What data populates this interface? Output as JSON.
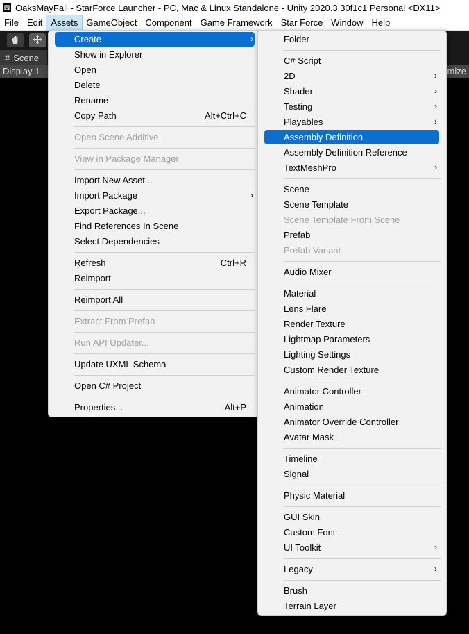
{
  "window": {
    "title": "OaksMayFall - StarForce Launcher - PC, Mac & Linux Standalone - Unity 2020.3.30f1c1 Personal <DX11>"
  },
  "menubar": [
    "File",
    "Edit",
    "Assets",
    "GameObject",
    "Component",
    "Game Framework",
    "Star Force",
    "Window",
    "Help"
  ],
  "scene": {
    "tab_label": "Scene",
    "tab_icon": "#",
    "display": "Display 1",
    "maximize": "imize"
  },
  "assets_menu": {
    "items": [
      {
        "label": "Create",
        "arrow": "›"
      },
      {
        "label": "Show in Explorer"
      },
      {
        "label": "Open"
      },
      {
        "label": "Delete"
      },
      {
        "label": "Rename"
      },
      {
        "label": "Copy Path",
        "shortcut": "Alt+Ctrl+C"
      },
      {
        "label": "Open Scene Additive"
      },
      {
        "label": "View in Package Manager"
      },
      {
        "label": "Import New Asset..."
      },
      {
        "label": "Import Package",
        "arrow": "›"
      },
      {
        "label": "Export Package..."
      },
      {
        "label": "Find References In Scene"
      },
      {
        "label": "Select Dependencies"
      },
      {
        "label": "Refresh",
        "shortcut": "Ctrl+R"
      },
      {
        "label": "Reimport"
      },
      {
        "label": "Reimport All"
      },
      {
        "label": "Extract From Prefab"
      },
      {
        "label": "Run API Updater..."
      },
      {
        "label": "Update UXML Schema"
      },
      {
        "label": "Open C# Project"
      },
      {
        "label": "Properties...",
        "shortcut": "Alt+P"
      }
    ]
  },
  "create_menu": {
    "items": [
      {
        "label": "Folder"
      },
      {
        "label": "C# Script"
      },
      {
        "label": "2D",
        "arrow": "›"
      },
      {
        "label": "Shader",
        "arrow": "›"
      },
      {
        "label": "Testing",
        "arrow": "›"
      },
      {
        "label": "Playables",
        "arrow": "›"
      },
      {
        "label": "Assembly Definition"
      },
      {
        "label": "Assembly Definition Reference"
      },
      {
        "label": "TextMeshPro",
        "arrow": "›"
      },
      {
        "label": "Scene"
      },
      {
        "label": "Scene Template"
      },
      {
        "label": "Scene Template From Scene"
      },
      {
        "label": "Prefab"
      },
      {
        "label": "Prefab Variant"
      },
      {
        "label": "Audio Mixer"
      },
      {
        "label": "Material"
      },
      {
        "label": "Lens Flare"
      },
      {
        "label": "Render Texture"
      },
      {
        "label": "Lightmap Parameters"
      },
      {
        "label": "Lighting Settings"
      },
      {
        "label": "Custom Render Texture"
      },
      {
        "label": "Animator Controller"
      },
      {
        "label": "Animation"
      },
      {
        "label": "Animator Override Controller"
      },
      {
        "label": "Avatar Mask"
      },
      {
        "label": "Timeline"
      },
      {
        "label": "Signal"
      },
      {
        "label": "Physic Material"
      },
      {
        "label": "GUI Skin"
      },
      {
        "label": "Custom Font"
      },
      {
        "label": "UI Toolkit",
        "arrow": "›"
      },
      {
        "label": "Legacy",
        "arrow": "›"
      },
      {
        "label": "Brush"
      },
      {
        "label": "Terrain Layer"
      }
    ]
  },
  "colors": {
    "highlight": "#0a6fd0",
    "menu_bg": "#f2f2f2",
    "disabled_text": "#a0a0a0"
  },
  "icons": [
    "unity-icon",
    "hand-tool-icon",
    "move-tool-icon",
    "chevron-right-icon"
  ]
}
